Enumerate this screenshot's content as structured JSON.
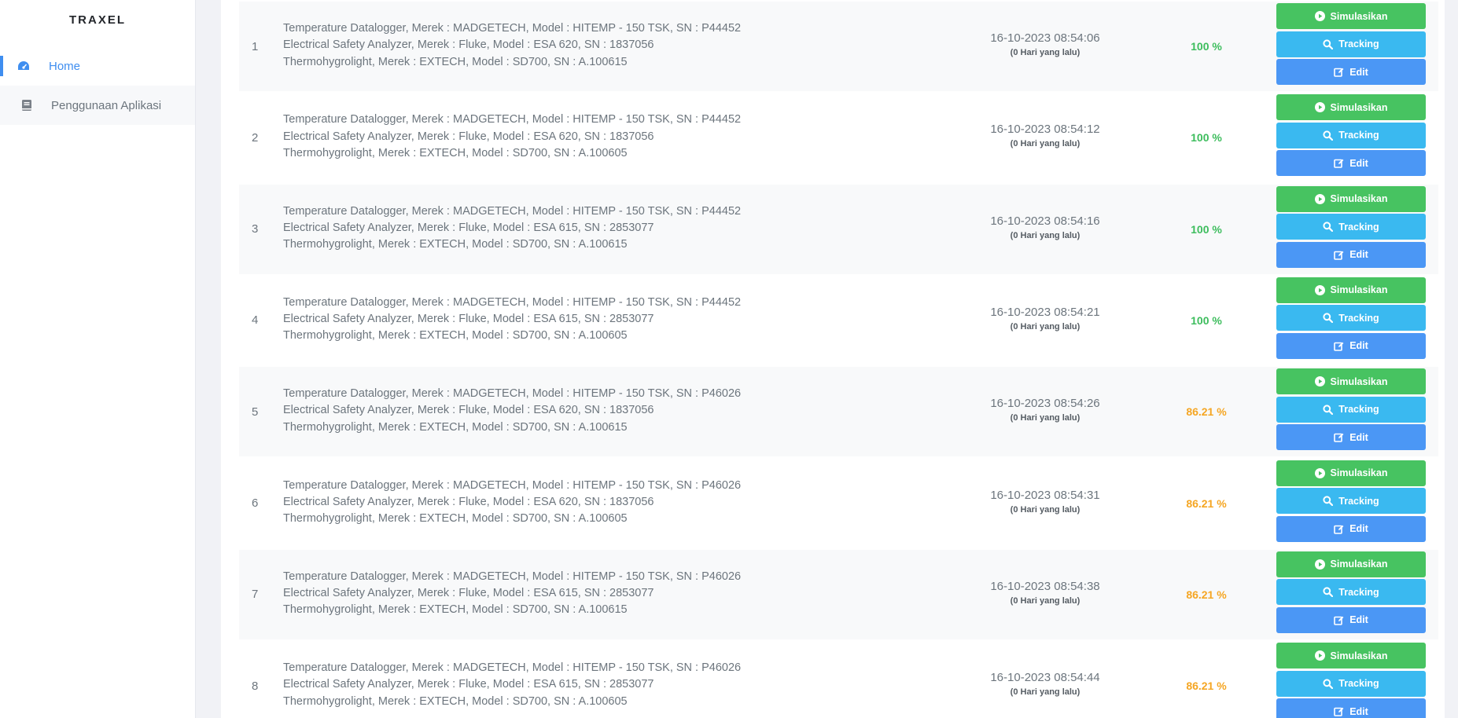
{
  "sidebar": {
    "brand": "TRAXEL",
    "items": [
      {
        "label": "Home",
        "icon": "dashboard-icon",
        "active": true
      },
      {
        "label": "Penggunaan Aplikasi",
        "icon": "book-icon",
        "active": false
      }
    ]
  },
  "actions": {
    "simulate_label": "Simulasikan",
    "tracking_label": "Tracking",
    "edit_label": "Edit"
  },
  "colors": {
    "accent": "#3f8ef0",
    "success": "#47c361",
    "info": "#3ab9f0",
    "primary": "#4b97f5",
    "warning": "#f5a623"
  },
  "rows": [
    {
      "no": "1",
      "items": [
        "Temperature Datalogger, Merek : MADGETECH, Model : HITEMP - 150 TSK, SN : P44452",
        "Electrical Safety Analyzer, Merek : Fluke, Model : ESA 620, SN : 1837056",
        "Thermohygrolight, Merek : EXTECH, Model : SD700, SN : A.100615"
      ],
      "datetime": "16-10-2023 08:54:06",
      "relative": "(0 Hari yang lalu)",
      "percent": "100 %",
      "status": "full"
    },
    {
      "no": "2",
      "items": [
        "Temperature Datalogger, Merek : MADGETECH, Model : HITEMP - 150 TSK, SN : P44452",
        "Electrical Safety Analyzer, Merek : Fluke, Model : ESA 620, SN : 1837056",
        "Thermohygrolight, Merek : EXTECH, Model : SD700, SN : A.100605"
      ],
      "datetime": "16-10-2023 08:54:12",
      "relative": "(0 Hari yang lalu)",
      "percent": "100 %",
      "status": "full"
    },
    {
      "no": "3",
      "items": [
        "Temperature Datalogger, Merek : MADGETECH, Model : HITEMP - 150 TSK, SN : P44452",
        "Electrical Safety Analyzer, Merek : Fluke, Model : ESA 615, SN : 2853077",
        "Thermohygrolight, Merek : EXTECH, Model : SD700, SN : A.100615"
      ],
      "datetime": "16-10-2023 08:54:16",
      "relative": "(0 Hari yang lalu)",
      "percent": "100 %",
      "status": "full"
    },
    {
      "no": "4",
      "items": [
        "Temperature Datalogger, Merek : MADGETECH, Model : HITEMP - 150 TSK, SN : P44452",
        "Electrical Safety Analyzer, Merek : Fluke, Model : ESA 615, SN : 2853077",
        "Thermohygrolight, Merek : EXTECH, Model : SD700, SN : A.100605"
      ],
      "datetime": "16-10-2023 08:54:21",
      "relative": "(0 Hari yang lalu)",
      "percent": "100 %",
      "status": "full"
    },
    {
      "no": "5",
      "items": [
        "Temperature Datalogger, Merek : MADGETECH, Model : HITEMP - 150 TSK, SN : P46026",
        "Electrical Safety Analyzer, Merek : Fluke, Model : ESA 620, SN : 1837056",
        "Thermohygrolight, Merek : EXTECH, Model : SD700, SN : A.100615"
      ],
      "datetime": "16-10-2023 08:54:26",
      "relative": "(0 Hari yang lalu)",
      "percent": "86.21 %",
      "status": "partial"
    },
    {
      "no": "6",
      "items": [
        "Temperature Datalogger, Merek : MADGETECH, Model : HITEMP - 150 TSK, SN : P46026",
        "Electrical Safety Analyzer, Merek : Fluke, Model : ESA 620, SN : 1837056",
        "Thermohygrolight, Merek : EXTECH, Model : SD700, SN : A.100605"
      ],
      "datetime": "16-10-2023 08:54:31",
      "relative": "(0 Hari yang lalu)",
      "percent": "86.21 %",
      "status": "partial"
    },
    {
      "no": "7",
      "items": [
        "Temperature Datalogger, Merek : MADGETECH, Model : HITEMP - 150 TSK, SN : P46026",
        "Electrical Safety Analyzer, Merek : Fluke, Model : ESA 615, SN : 2853077",
        "Thermohygrolight, Merek : EXTECH, Model : SD700, SN : A.100615"
      ],
      "datetime": "16-10-2023 08:54:38",
      "relative": "(0 Hari yang lalu)",
      "percent": "86.21 %",
      "status": "partial"
    },
    {
      "no": "8",
      "items": [
        "Temperature Datalogger, Merek : MADGETECH, Model : HITEMP - 150 TSK, SN : P46026",
        "Electrical Safety Analyzer, Merek : Fluke, Model : ESA 615, SN : 2853077",
        "Thermohygrolight, Merek : EXTECH, Model : SD700, SN : A.100605"
      ],
      "datetime": "16-10-2023 08:54:44",
      "relative": "(0 Hari yang lalu)",
      "percent": "86.21 %",
      "status": "partial"
    }
  ]
}
